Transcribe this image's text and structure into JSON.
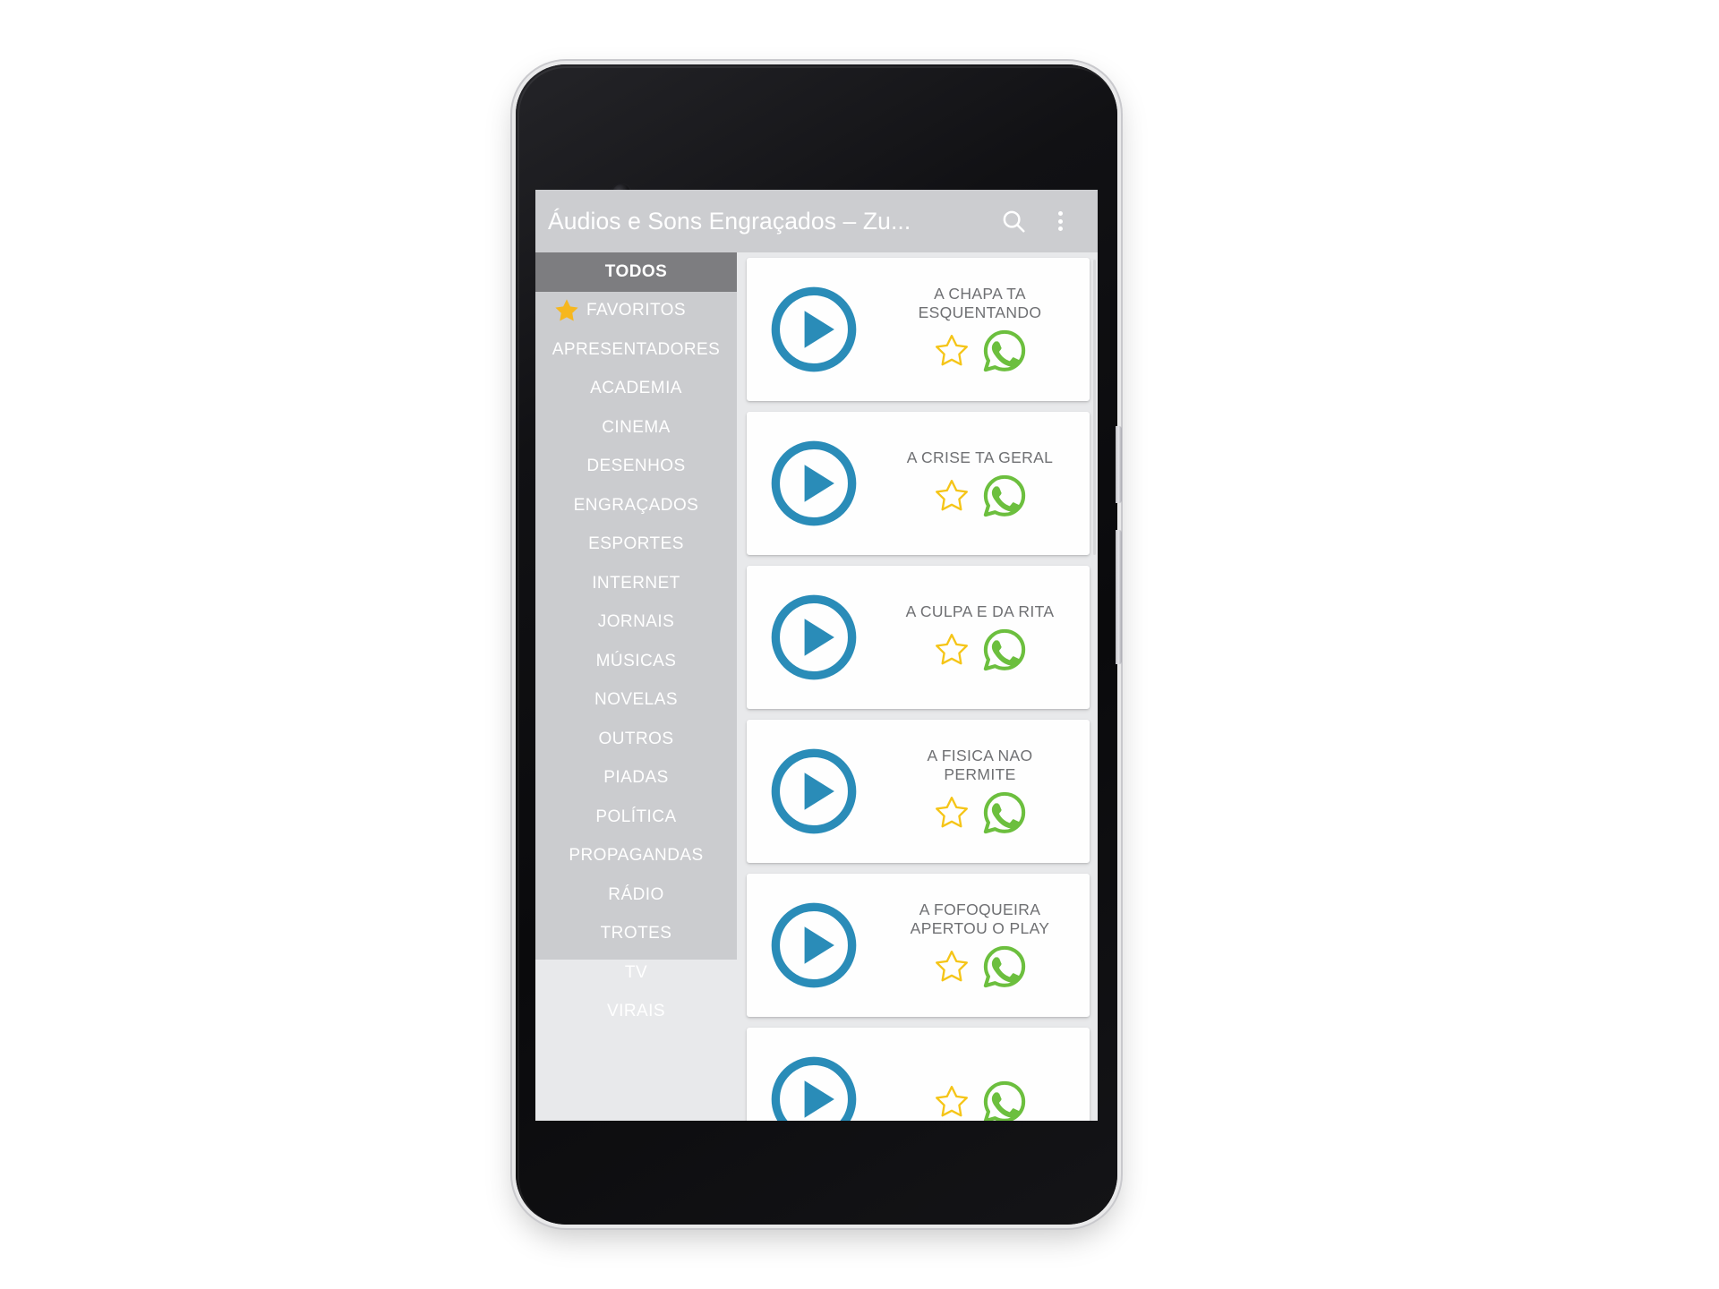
{
  "app": {
    "title": "Áudios e Sons Engraçados – Zu...",
    "search_icon": "search-icon",
    "overflow_icon": "overflow-menu-icon",
    "accent_play_color": "#2a8cb8",
    "accent_star_color": "#f5c518",
    "accent_whatsapp_color": "#6cbf3e",
    "appbar_bg": "#cccdd0",
    "sidebar_bg": "#cbcccf",
    "sidebar_selected_bg": "#7d7d80",
    "content_bg": "#e8e9eb"
  },
  "sidebar": {
    "items": [
      {
        "label": "TODOS",
        "selected": true,
        "icon": null
      },
      {
        "label": "FAVORITOS",
        "selected": false,
        "icon": "star-filled-icon"
      },
      {
        "label": "APRESENTADORES",
        "selected": false,
        "icon": null
      },
      {
        "label": "ACADEMIA",
        "selected": false,
        "icon": null
      },
      {
        "label": "CINEMA",
        "selected": false,
        "icon": null
      },
      {
        "label": "DESENHOS",
        "selected": false,
        "icon": null
      },
      {
        "label": "ENGRAÇADOS",
        "selected": false,
        "icon": null
      },
      {
        "label": "ESPORTES",
        "selected": false,
        "icon": null
      },
      {
        "label": "INTERNET",
        "selected": false,
        "icon": null
      },
      {
        "label": "JORNAIS",
        "selected": false,
        "icon": null
      },
      {
        "label": "MÚSICAS",
        "selected": false,
        "icon": null
      },
      {
        "label": "NOVELAS",
        "selected": false,
        "icon": null
      },
      {
        "label": "OUTROS",
        "selected": false,
        "icon": null
      },
      {
        "label": "PIADAS",
        "selected": false,
        "icon": null
      },
      {
        "label": "POLÍTICA",
        "selected": false,
        "icon": null
      },
      {
        "label": "PROPAGANDAS",
        "selected": false,
        "icon": null
      },
      {
        "label": "RÁDIO",
        "selected": false,
        "icon": null
      },
      {
        "label": "TROTES",
        "selected": false,
        "icon": null
      },
      {
        "label": "TV",
        "selected": false,
        "icon": null
      },
      {
        "label": "VIRAIS",
        "selected": false,
        "icon": null
      }
    ]
  },
  "list": {
    "cards": [
      {
        "title": "A CHAPA TA ESQUENTANDO",
        "play_icon": "play-circle-icon",
        "favorite_icon": "star-outline-icon",
        "share_icon": "whatsapp-icon"
      },
      {
        "title": "A CRISE TA GERAL",
        "play_icon": "play-circle-icon",
        "favorite_icon": "star-outline-icon",
        "share_icon": "whatsapp-icon"
      },
      {
        "title": "A CULPA E DA RITA",
        "play_icon": "play-circle-icon",
        "favorite_icon": "star-outline-icon",
        "share_icon": "whatsapp-icon"
      },
      {
        "title": "A FISICA NAO PERMITE",
        "play_icon": "play-circle-icon",
        "favorite_icon": "star-outline-icon",
        "share_icon": "whatsapp-icon"
      },
      {
        "title": "A FOFOQUEIRA APERTOU O PLAY",
        "play_icon": "play-circle-icon",
        "favorite_icon": "star-outline-icon",
        "share_icon": "whatsapp-icon"
      },
      {
        "title": "",
        "play_icon": "play-circle-icon",
        "favorite_icon": "star-outline-icon",
        "share_icon": "whatsapp-icon"
      }
    ]
  },
  "device": {
    "camera_icon": "front-camera-icon",
    "earpiece_icon": "earpiece-speaker-icon",
    "bottom_speaker_icon": "bottom-speaker-icon",
    "power_button": "power-button",
    "volume_button": "volume-button"
  }
}
